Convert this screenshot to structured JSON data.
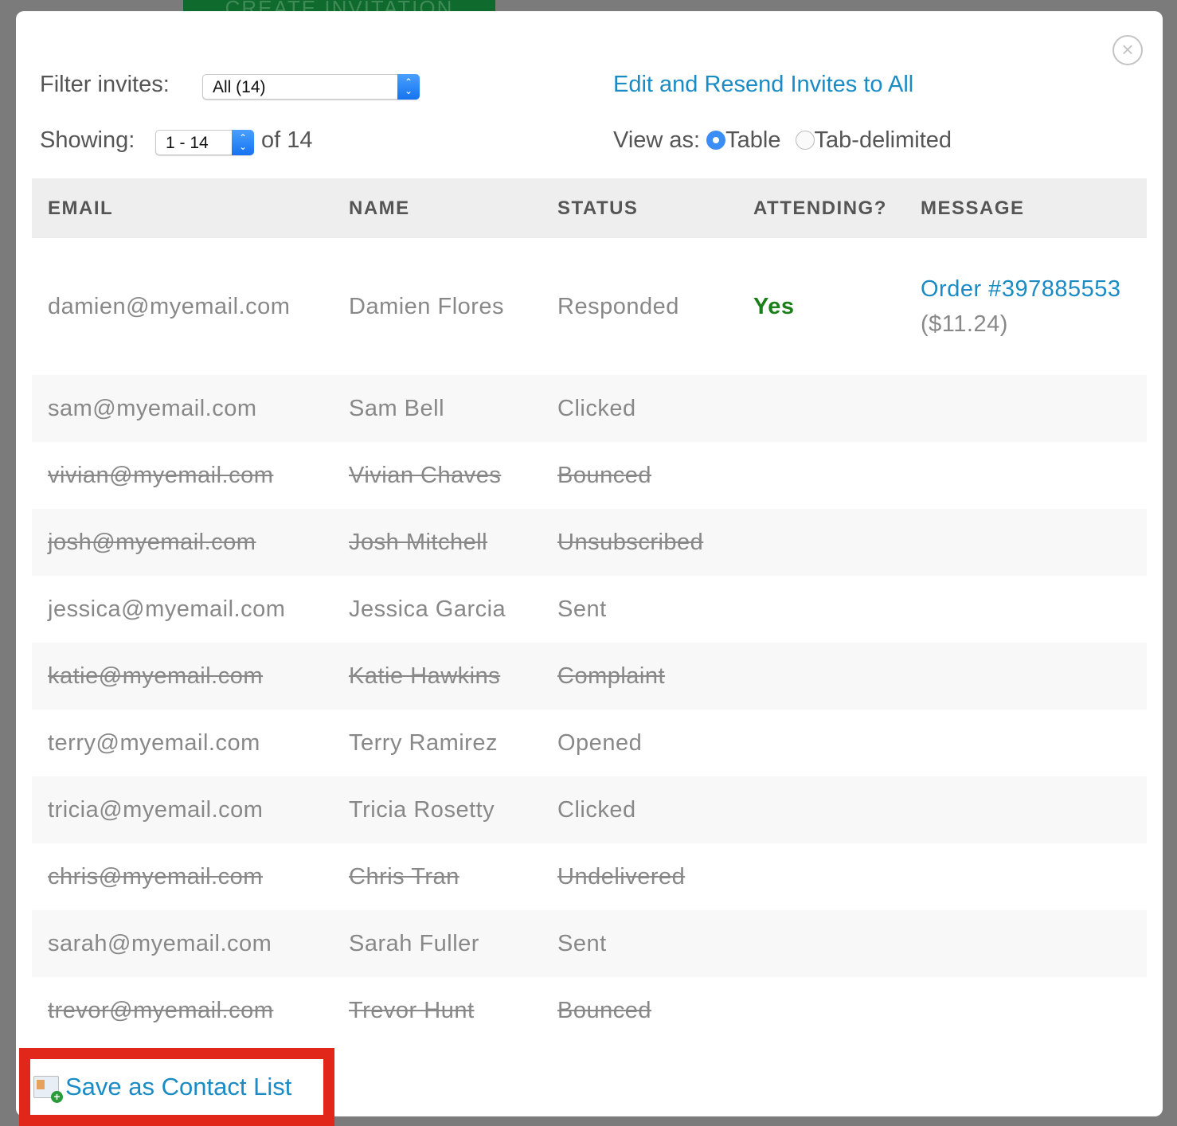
{
  "background": {
    "button_label": "CREATE INVITATION"
  },
  "filter": {
    "label": "Filter invites:",
    "value": "All (14)"
  },
  "showing": {
    "label": "Showing:",
    "value": "1 - 14",
    "suffix": "of 14"
  },
  "resend_link": "Edit and Resend Invites to All",
  "view_as": {
    "label": "View as:",
    "options": [
      {
        "label": "Table",
        "selected": true
      },
      {
        "label": "Tab-delimited",
        "selected": false
      }
    ]
  },
  "table": {
    "headers": [
      "EMAIL",
      "NAME",
      "STATUS",
      "ATTENDING?",
      "MESSAGE"
    ],
    "rows": [
      {
        "email": "damien@myemail.com",
        "name": "Damien Flores",
        "status": "Responded",
        "attending": "Yes",
        "message_link": "Order #397885553",
        "message_extra": "($11.24)",
        "struck": false
      },
      {
        "email": "sam@myemail.com",
        "name": "Sam Bell",
        "status": "Clicked",
        "struck": false
      },
      {
        "email": "vivian@myemail.com",
        "name": "Vivian Chaves",
        "status": "Bounced",
        "struck": true
      },
      {
        "email": "josh@myemail.com",
        "name": "Josh Mitchell",
        "status": "Unsubscribed",
        "struck": true
      },
      {
        "email": "jessica@myemail.com",
        "name": "Jessica Garcia",
        "status": "Sent",
        "struck": false
      },
      {
        "email": "katie@myemail.com",
        "name": "Katie Hawkins",
        "status": "Complaint",
        "struck": true
      },
      {
        "email": "terry@myemail.com",
        "name": "Terry Ramirez",
        "status": "Opened",
        "struck": false
      },
      {
        "email": "tricia@myemail.com",
        "name": "Tricia Rosetty",
        "status": "Clicked",
        "struck": false
      },
      {
        "email": "chris@myemail.com",
        "name": "Chris Tran",
        "status": "Undelivered",
        "struck": true
      },
      {
        "email": "sarah@myemail.com",
        "name": "Sarah Fuller",
        "status": "Sent",
        "struck": false
      },
      {
        "email": "trevor@myemail.com",
        "name": "Trevor Hunt",
        "status": "Bounced",
        "struck": true
      }
    ]
  },
  "save_contact_list": "Save as Contact List",
  "colors": {
    "link": "#1a8bc4",
    "attending_yes": "#1a7f1a",
    "highlight": "#e0271a"
  }
}
